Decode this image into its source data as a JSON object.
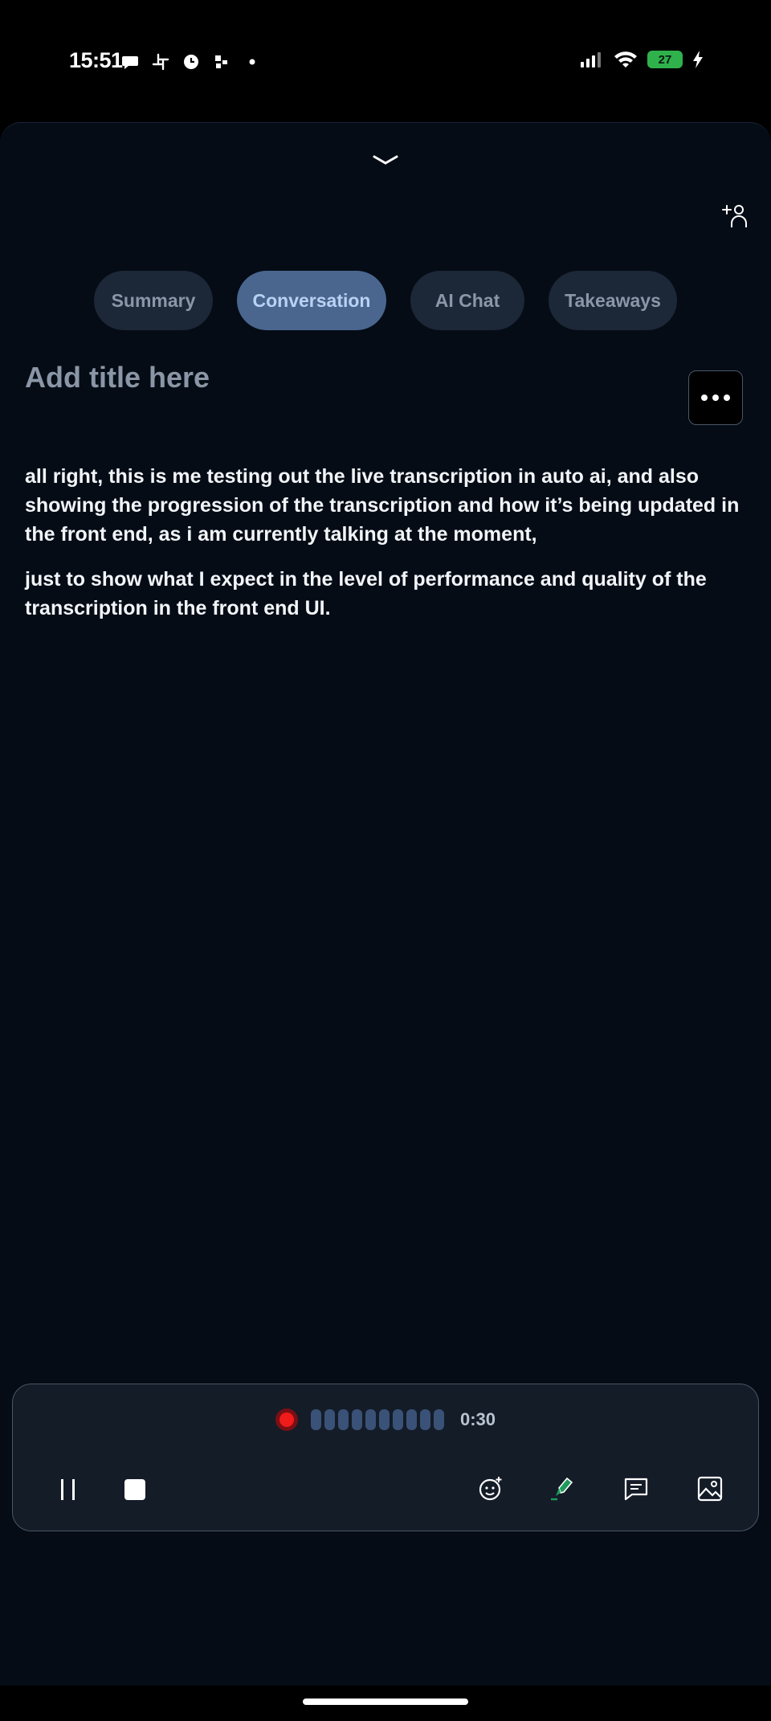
{
  "status_bar": {
    "time": "15:51",
    "notification_icons": [
      "chat-bubble-icon",
      "slack-icon",
      "clock-app-icon",
      "app-icon",
      "dot-icon"
    ],
    "battery_level": "27",
    "battery_color": "#2fb24c",
    "status_icons": [
      "signal-icon",
      "wifi-icon",
      "battery-icon",
      "charging-icon"
    ]
  },
  "header": {
    "collapse_icon": "chevron-down-icon",
    "add_person_icon": "add-person-icon"
  },
  "tabs": [
    {
      "label": "Summary",
      "active": false
    },
    {
      "label": "Conversation",
      "active": true
    },
    {
      "label": "AI Chat",
      "active": false
    },
    {
      "label": "Takeaways",
      "active": false
    }
  ],
  "title": {
    "placeholder": "Add title here",
    "more_icon": "more-horizontal-icon"
  },
  "transcript": [
    "all right, this is me testing out the live transcription in auto ai, and also showing the progression of the transcription and how it’s being updated in the front end, as i am currently talking at the moment,",
    "just to show what I expect in the level of performance and quality of the transcription in the front end UI."
  ],
  "recorder": {
    "status": "recording",
    "elapsed": "0:30",
    "record_color": "#f01b1b",
    "controls": [
      "pause-icon",
      "stop-icon",
      "emoji-add-icon",
      "highlight-pen-icon",
      "comment-icon",
      "image-icon"
    ]
  },
  "colors": {
    "background": "#050c16",
    "tab_active": "#4a668f",
    "tab_inactive": "#1c2737"
  }
}
